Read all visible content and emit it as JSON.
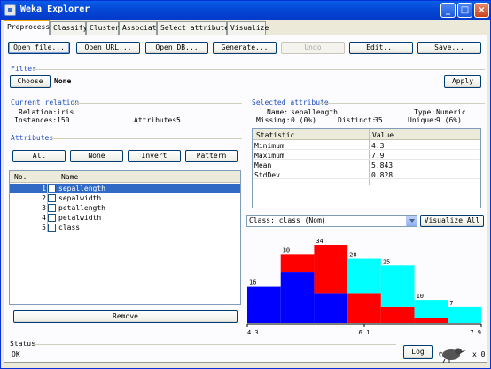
{
  "window": {
    "title": "Weka Explorer",
    "controls": {
      "minimize": "_",
      "maximize": "□",
      "close": "×"
    }
  },
  "tabs": [
    "Preprocess",
    "Classify",
    "Cluster",
    "Associate",
    "Select attributes",
    "Visualize"
  ],
  "toolbar": {
    "open_file": "Open file...",
    "open_url": "Open URL...",
    "open_db": "Open DB...",
    "generate": "Generate...",
    "undo": "Undo",
    "edit": "Edit...",
    "save": "Save..."
  },
  "filter": {
    "section_title": "Filter",
    "choose_label": "Choose",
    "value": "None",
    "apply_label": "Apply"
  },
  "current_relation": {
    "section_title": "Current relation",
    "relation_label": "Relation:",
    "relation_value": "iris",
    "instances_label": "Instances:",
    "instances_value": "150",
    "attributes_label": "Attributes:",
    "attributes_value": "5"
  },
  "attributes": {
    "section_title": "Attributes",
    "buttons": {
      "all": "All",
      "none": "None",
      "invert": "Invert",
      "pattern": "Pattern"
    },
    "columns": [
      "No.",
      "Name"
    ],
    "rows": [
      {
        "no": "1",
        "name": "sepallength",
        "selected": true
      },
      {
        "no": "2",
        "name": "sepalwidth",
        "selected": false
      },
      {
        "no": "3",
        "name": "petallength",
        "selected": false
      },
      {
        "no": "4",
        "name": "petalwidth",
        "selected": false
      },
      {
        "no": "5",
        "name": "class",
        "selected": false
      }
    ],
    "remove_label": "Remove"
  },
  "selected_attribute": {
    "section_title": "Selected attribute",
    "name_label": "Name:",
    "name_value": "sepallength",
    "type_label": "Type:",
    "type_value": "Numeric",
    "missing_label": "Missing:",
    "missing_value": "0 (0%)",
    "distinct_label": "Distinct:",
    "distinct_value": "35",
    "unique_label": "Unique:",
    "unique_value": "9 (6%)",
    "stats_columns": [
      "Statistic",
      "Value"
    ],
    "stats": [
      {
        "statistic": "Minimum",
        "value": "4.3"
      },
      {
        "statistic": "Maximum",
        "value": "7.9"
      },
      {
        "statistic": "Mean",
        "value": "5.843"
      },
      {
        "statistic": "StdDev",
        "value": "0.828"
      }
    ]
  },
  "class_select": {
    "value": "Class: class (Nom)",
    "visualize_all": "Visualize All"
  },
  "status": {
    "section_title": "Status",
    "message": "OK",
    "log_label": "Log",
    "x_count": "x 0"
  },
  "colors": {
    "blue": "#0000ff",
    "red": "#ff0000",
    "cyan": "#00ffff",
    "accent": "#1f4fbf"
  },
  "chart_data": {
    "type": "bar",
    "stacked": true,
    "x_ticks": [
      "4.3",
      "6.1",
      "7.9"
    ],
    "bin_totals": [
      16,
      30,
      34,
      28,
      25,
      10,
      7
    ],
    "series": [
      {
        "color": "#0000ff",
        "values": [
          16,
          22,
          13,
          0,
          0,
          0,
          0
        ]
      },
      {
        "color": "#ff0000",
        "values": [
          0,
          8,
          21,
          13,
          7,
          2,
          0
        ]
      },
      {
        "color": "#00ffff",
        "values": [
          0,
          0,
          0,
          15,
          18,
          8,
          7
        ]
      }
    ],
    "ylim": [
      0,
      34
    ]
  }
}
